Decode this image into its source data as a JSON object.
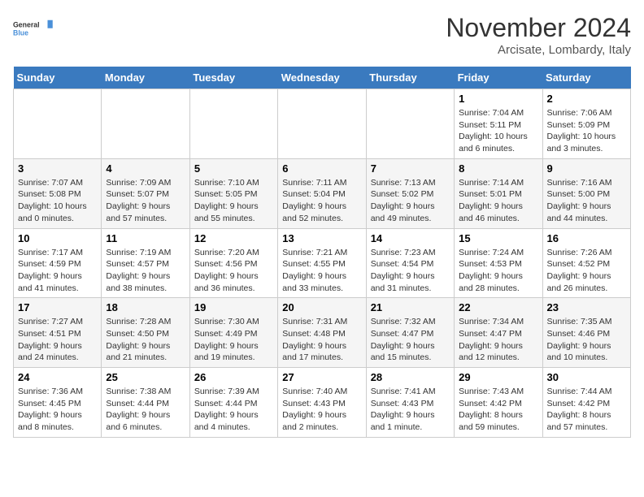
{
  "logo": {
    "line1": "General",
    "line2": "Blue"
  },
  "title": "November 2024",
  "location": "Arcisate, Lombardy, Italy",
  "days_of_week": [
    "Sunday",
    "Monday",
    "Tuesday",
    "Wednesday",
    "Thursday",
    "Friday",
    "Saturday"
  ],
  "weeks": [
    [
      {
        "day": "",
        "info": ""
      },
      {
        "day": "",
        "info": ""
      },
      {
        "day": "",
        "info": ""
      },
      {
        "day": "",
        "info": ""
      },
      {
        "day": "",
        "info": ""
      },
      {
        "day": "1",
        "info": "Sunrise: 7:04 AM\nSunset: 5:11 PM\nDaylight: 10 hours and 6 minutes."
      },
      {
        "day": "2",
        "info": "Sunrise: 7:06 AM\nSunset: 5:09 PM\nDaylight: 10 hours and 3 minutes."
      }
    ],
    [
      {
        "day": "3",
        "info": "Sunrise: 7:07 AM\nSunset: 5:08 PM\nDaylight: 10 hours and 0 minutes."
      },
      {
        "day": "4",
        "info": "Sunrise: 7:09 AM\nSunset: 5:07 PM\nDaylight: 9 hours and 57 minutes."
      },
      {
        "day": "5",
        "info": "Sunrise: 7:10 AM\nSunset: 5:05 PM\nDaylight: 9 hours and 55 minutes."
      },
      {
        "day": "6",
        "info": "Sunrise: 7:11 AM\nSunset: 5:04 PM\nDaylight: 9 hours and 52 minutes."
      },
      {
        "day": "7",
        "info": "Sunrise: 7:13 AM\nSunset: 5:02 PM\nDaylight: 9 hours and 49 minutes."
      },
      {
        "day": "8",
        "info": "Sunrise: 7:14 AM\nSunset: 5:01 PM\nDaylight: 9 hours and 46 minutes."
      },
      {
        "day": "9",
        "info": "Sunrise: 7:16 AM\nSunset: 5:00 PM\nDaylight: 9 hours and 44 minutes."
      }
    ],
    [
      {
        "day": "10",
        "info": "Sunrise: 7:17 AM\nSunset: 4:59 PM\nDaylight: 9 hours and 41 minutes."
      },
      {
        "day": "11",
        "info": "Sunrise: 7:19 AM\nSunset: 4:57 PM\nDaylight: 9 hours and 38 minutes."
      },
      {
        "day": "12",
        "info": "Sunrise: 7:20 AM\nSunset: 4:56 PM\nDaylight: 9 hours and 36 minutes."
      },
      {
        "day": "13",
        "info": "Sunrise: 7:21 AM\nSunset: 4:55 PM\nDaylight: 9 hours and 33 minutes."
      },
      {
        "day": "14",
        "info": "Sunrise: 7:23 AM\nSunset: 4:54 PM\nDaylight: 9 hours and 31 minutes."
      },
      {
        "day": "15",
        "info": "Sunrise: 7:24 AM\nSunset: 4:53 PM\nDaylight: 9 hours and 28 minutes."
      },
      {
        "day": "16",
        "info": "Sunrise: 7:26 AM\nSunset: 4:52 PM\nDaylight: 9 hours and 26 minutes."
      }
    ],
    [
      {
        "day": "17",
        "info": "Sunrise: 7:27 AM\nSunset: 4:51 PM\nDaylight: 9 hours and 24 minutes."
      },
      {
        "day": "18",
        "info": "Sunrise: 7:28 AM\nSunset: 4:50 PM\nDaylight: 9 hours and 21 minutes."
      },
      {
        "day": "19",
        "info": "Sunrise: 7:30 AM\nSunset: 4:49 PM\nDaylight: 9 hours and 19 minutes."
      },
      {
        "day": "20",
        "info": "Sunrise: 7:31 AM\nSunset: 4:48 PM\nDaylight: 9 hours and 17 minutes."
      },
      {
        "day": "21",
        "info": "Sunrise: 7:32 AM\nSunset: 4:47 PM\nDaylight: 9 hours and 15 minutes."
      },
      {
        "day": "22",
        "info": "Sunrise: 7:34 AM\nSunset: 4:47 PM\nDaylight: 9 hours and 12 minutes."
      },
      {
        "day": "23",
        "info": "Sunrise: 7:35 AM\nSunset: 4:46 PM\nDaylight: 9 hours and 10 minutes."
      }
    ],
    [
      {
        "day": "24",
        "info": "Sunrise: 7:36 AM\nSunset: 4:45 PM\nDaylight: 9 hours and 8 minutes."
      },
      {
        "day": "25",
        "info": "Sunrise: 7:38 AM\nSunset: 4:44 PM\nDaylight: 9 hours and 6 minutes."
      },
      {
        "day": "26",
        "info": "Sunrise: 7:39 AM\nSunset: 4:44 PM\nDaylight: 9 hours and 4 minutes."
      },
      {
        "day": "27",
        "info": "Sunrise: 7:40 AM\nSunset: 4:43 PM\nDaylight: 9 hours and 2 minutes."
      },
      {
        "day": "28",
        "info": "Sunrise: 7:41 AM\nSunset: 4:43 PM\nDaylight: 9 hours and 1 minute."
      },
      {
        "day": "29",
        "info": "Sunrise: 7:43 AM\nSunset: 4:42 PM\nDaylight: 8 hours and 59 minutes."
      },
      {
        "day": "30",
        "info": "Sunrise: 7:44 AM\nSunset: 4:42 PM\nDaylight: 8 hours and 57 minutes."
      }
    ]
  ]
}
